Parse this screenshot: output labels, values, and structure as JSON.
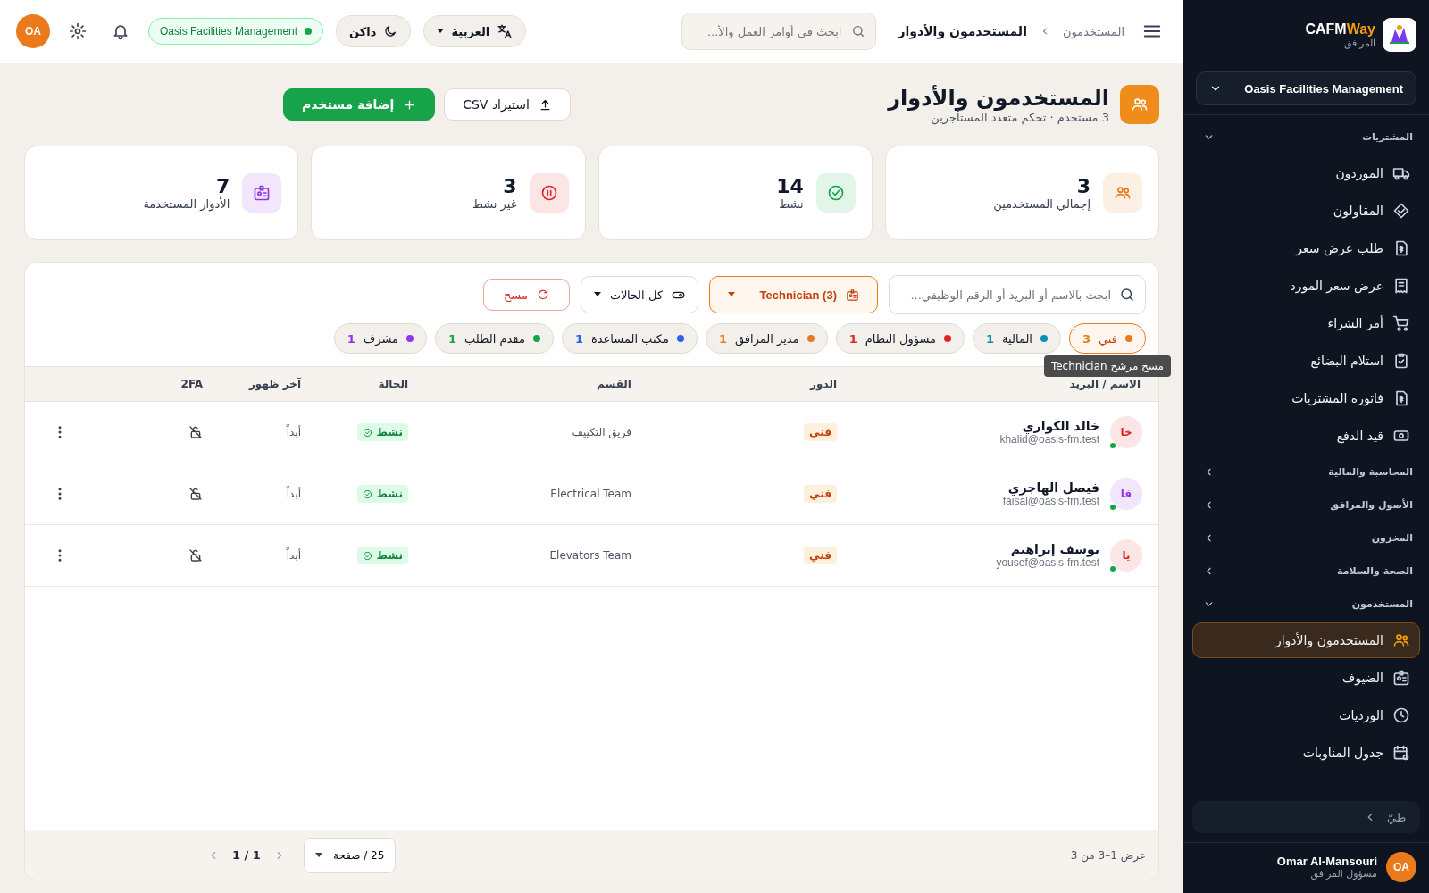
{
  "sidebar": {
    "brand": "CAFM",
    "brand_accent": "Way",
    "brand_sub": "المرافق",
    "org": "Oasis Facilities Management",
    "sections": [
      {
        "title": "المشتريات",
        "expanded": true,
        "items": [
          {
            "label": "الموردون",
            "selected": false
          },
          {
            "label": "المقاولون",
            "selected": false
          },
          {
            "label": "طلب عرض سعر",
            "selected": false
          },
          {
            "label": "عرض سعر المورد",
            "selected": false
          },
          {
            "label": "أمر الشراء",
            "selected": false
          },
          {
            "label": "استلام البضائع",
            "selected": false
          },
          {
            "label": "فاتورة المشتريات",
            "selected": false
          },
          {
            "label": "قيد الدفع",
            "selected": false
          }
        ]
      },
      {
        "title": "المحاسبة والمالية",
        "expanded": false
      },
      {
        "title": "الأصول والمرافق",
        "expanded": false
      },
      {
        "title": "المخزون",
        "expanded": false
      },
      {
        "title": "الصحة والسلامة",
        "expanded": false
      },
      {
        "title": "المستخدمون",
        "expanded": true,
        "items": [
          {
            "label": "المستخدمون والأدوار",
            "selected": true
          },
          {
            "label": "الضيوف",
            "selected": false
          },
          {
            "label": "الورديات",
            "selected": false
          },
          {
            "label": "جدول المناوبات",
            "selected": false
          }
        ]
      }
    ],
    "collapse": "طيّ",
    "user": {
      "name": "Omar Al-Mansouri",
      "role": "مسؤول المرافق",
      "initials": "OA"
    }
  },
  "topbar": {
    "breadcrumb": [
      "المستخدمون",
      "المستخدمون والأدوار"
    ],
    "search": {
      "placeholder": "ابحث في أوامر العمل والأ..."
    },
    "language": "العربية",
    "theme": "داكن",
    "org": "Oasis Facilities Management",
    "avatar": "OA"
  },
  "header": {
    "title": "المستخدمون والأدوار",
    "subtitle": "3 مستخدم · تحكم متعدد المستأجرين",
    "buttons": [
      {
        "label": "استيراد CSV",
        "kind": "secondary"
      },
      {
        "label": "إضافة مستخدم",
        "kind": "primary"
      }
    ]
  },
  "stats": [
    {
      "value": "3",
      "label": "إجمالي المستخدمين",
      "color": "#ea7a1c"
    },
    {
      "value": "14",
      "label": "نشط",
      "color": "#16a34a"
    },
    {
      "value": "3",
      "label": "غير نشط",
      "color": "#dc2626"
    },
    {
      "value": "7",
      "label": "الأدوار المستخدمة",
      "color": "#9333ea"
    }
  ],
  "filters": {
    "search": {
      "placeholder": "ابحث بالاسم أو البريد أو الرقم الوظيفي..."
    },
    "role": {
      "value": "Technician (3)",
      "active": true
    },
    "status": {
      "value": "كل الحالات",
      "active": false
    },
    "clear": "مسح",
    "chips": [
      {
        "label": "فني",
        "count": "3",
        "color": "#ea7a1c",
        "selected": true
      },
      {
        "label": "المالية",
        "count": "1",
        "color": "#0891b2",
        "selected": false
      },
      {
        "label": "مسؤول النظام",
        "count": "1",
        "color": "#dc2626",
        "selected": false
      },
      {
        "label": "مدير المرافق",
        "count": "1",
        "color": "#ea7a1c",
        "selected": false
      },
      {
        "label": "مكتب المساعدة",
        "count": "1",
        "color": "#2563eb",
        "selected": false
      },
      {
        "label": "مقدم الطلب",
        "count": "1",
        "color": "#16a34a",
        "selected": false
      },
      {
        "label": "مشرف",
        "count": "1",
        "color": "#9333ea",
        "selected": false
      }
    ],
    "tooltip": "مسح مرشح Technician"
  },
  "table": {
    "columns": [
      "الاسم / البريد",
      "الدور",
      "القسم",
      "الحالة",
      "آخر ظهور",
      "2FA"
    ],
    "rows": [
      {
        "initials": "خا",
        "color": "#dc2626",
        "name": "خالد الكواري",
        "email": "khalid@oasis-fm.test",
        "online": true,
        "role": "فني",
        "department": "فريق التكييف",
        "status": "نشط",
        "last_seen": "أبداً",
        "twofa": false
      },
      {
        "initials": "فا",
        "color": "#9333ea",
        "name": "فيصل الهاجري",
        "email": "faisal@oasis-fm.test",
        "online": true,
        "role": "فني",
        "department": "Electrical Team",
        "status": "نشط",
        "last_seen": "أبداً",
        "twofa": false
      },
      {
        "initials": "يا",
        "color": "#dc2626",
        "name": "يوسف إبراهيم",
        "email": "yousef@oasis-fm.test",
        "online": true,
        "role": "فني",
        "department": "Elevators Team",
        "status": "نشط",
        "last_seen": "أبداً",
        "twofa": false
      }
    ]
  },
  "footer": {
    "summary": "عرض 1–3 من 3",
    "page_size": "25 / صفحة",
    "pages": "1 / 1"
  }
}
